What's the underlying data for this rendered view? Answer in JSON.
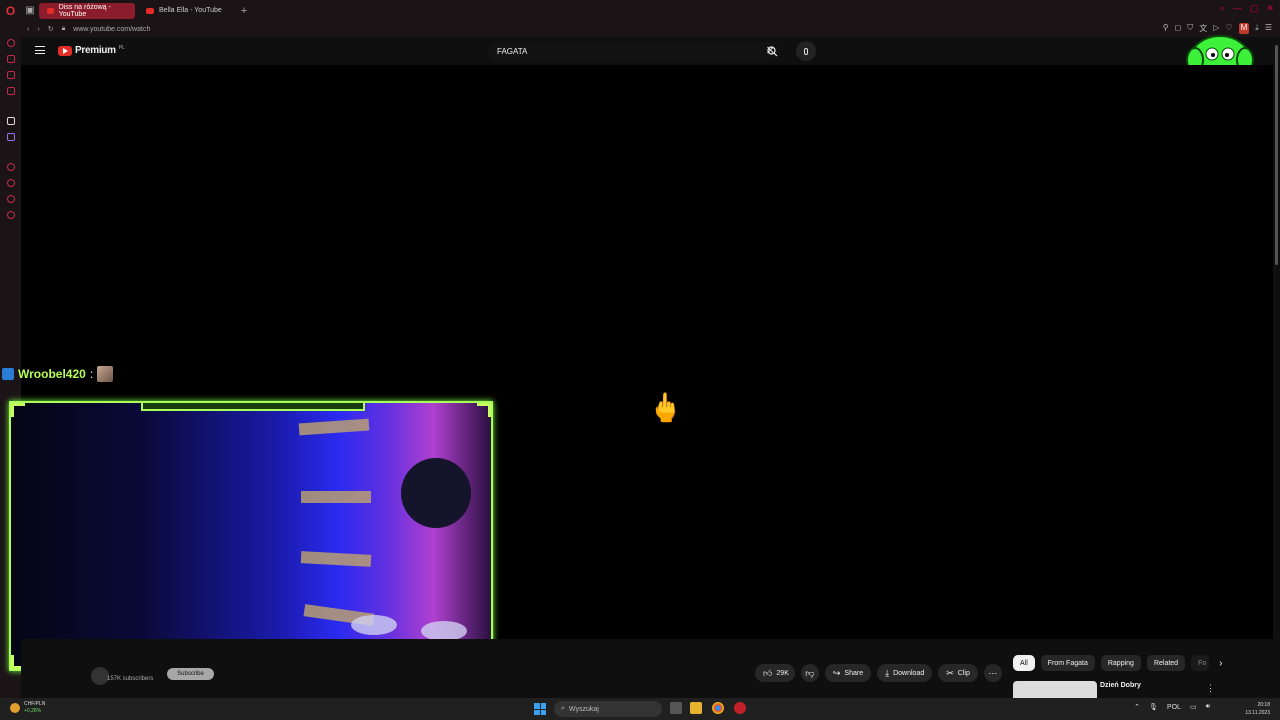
{
  "browser": {
    "tabs": [
      {
        "label": "Diss na różową - YouTube",
        "active": true
      },
      {
        "label": "Bella Ella - YouTube",
        "active": false
      }
    ],
    "url": "www.youtube.com/watch",
    "accent_color": "#e0323a"
  },
  "youtube": {
    "brand": "Premium",
    "country": "PL",
    "search_value": "FAGATA",
    "video_emoji": "🖕"
  },
  "overlay": {
    "chat_user": "Wroobel420",
    "chat_separator": ":",
    "frame_color": "#a8ff5a"
  },
  "below_video": {
    "channel_subs": "157K subscribers",
    "subscribe_label": "Subscribe",
    "actions": {
      "likes": "29K",
      "share": "Share",
      "download": "Download",
      "clip": "Clip"
    },
    "chips": [
      "All",
      "From Fagata",
      "Rapping",
      "Related",
      "Fo"
    ],
    "recommendation_title": "Dzień Dobry"
  },
  "taskbar": {
    "weather_label": "CHF/PLN",
    "weather_change": "+0,28%",
    "search_placeholder": "Wyszukaj",
    "lang": "POL",
    "time": "20:18",
    "date": "13.11.2023"
  }
}
